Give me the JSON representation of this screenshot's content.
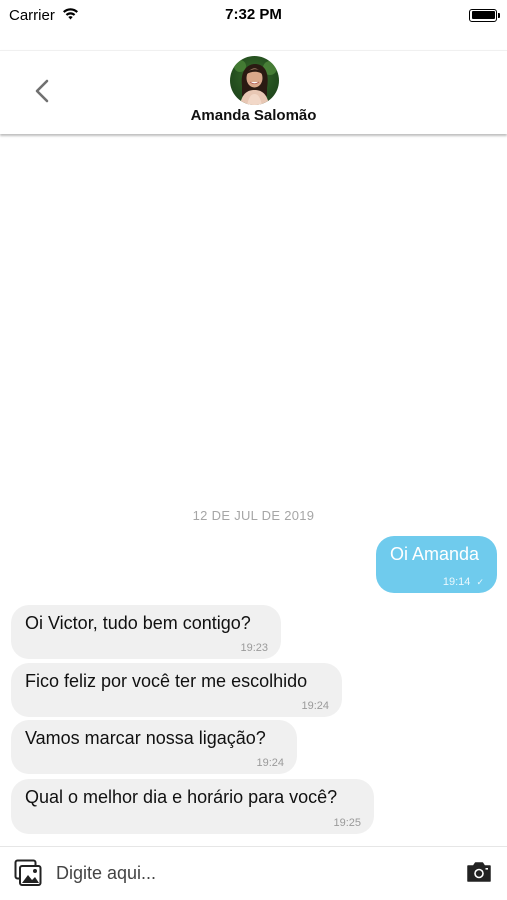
{
  "status_bar": {
    "carrier": "Carrier",
    "time": "7:32 PM"
  },
  "header": {
    "contact_name": "Amanda Salomão"
  },
  "chat": {
    "date_separator": "12 DE JUL DE 2019",
    "messages": [
      {
        "direction": "outgoing",
        "text": "Oi Amanda",
        "time": "19:14",
        "status_mark": "✓"
      },
      {
        "direction": "incoming",
        "text": "Oi Victor, tudo bem contigo?",
        "time": "19:23"
      },
      {
        "direction": "incoming",
        "text": "Fico feliz por você ter me escolhido",
        "time": "19:24"
      },
      {
        "direction": "incoming",
        "text": "Vamos marcar nossa ligação?",
        "time": "19:24"
      },
      {
        "direction": "incoming",
        "text": "Qual o melhor dia e horário para você?",
        "time": "19:25"
      }
    ]
  },
  "composer": {
    "placeholder": "Digite aqui...",
    "value": ""
  },
  "icons": {
    "wifi": "wifi-icon",
    "battery": "battery-icon",
    "back": "chevron-left-icon",
    "gallery": "image-gallery-icon",
    "camera": "camera-icon"
  },
  "colors": {
    "outgoing_bubble": "#6fcbed",
    "incoming_bubble": "#f0f0f0",
    "date_text": "#a6a6a6"
  }
}
